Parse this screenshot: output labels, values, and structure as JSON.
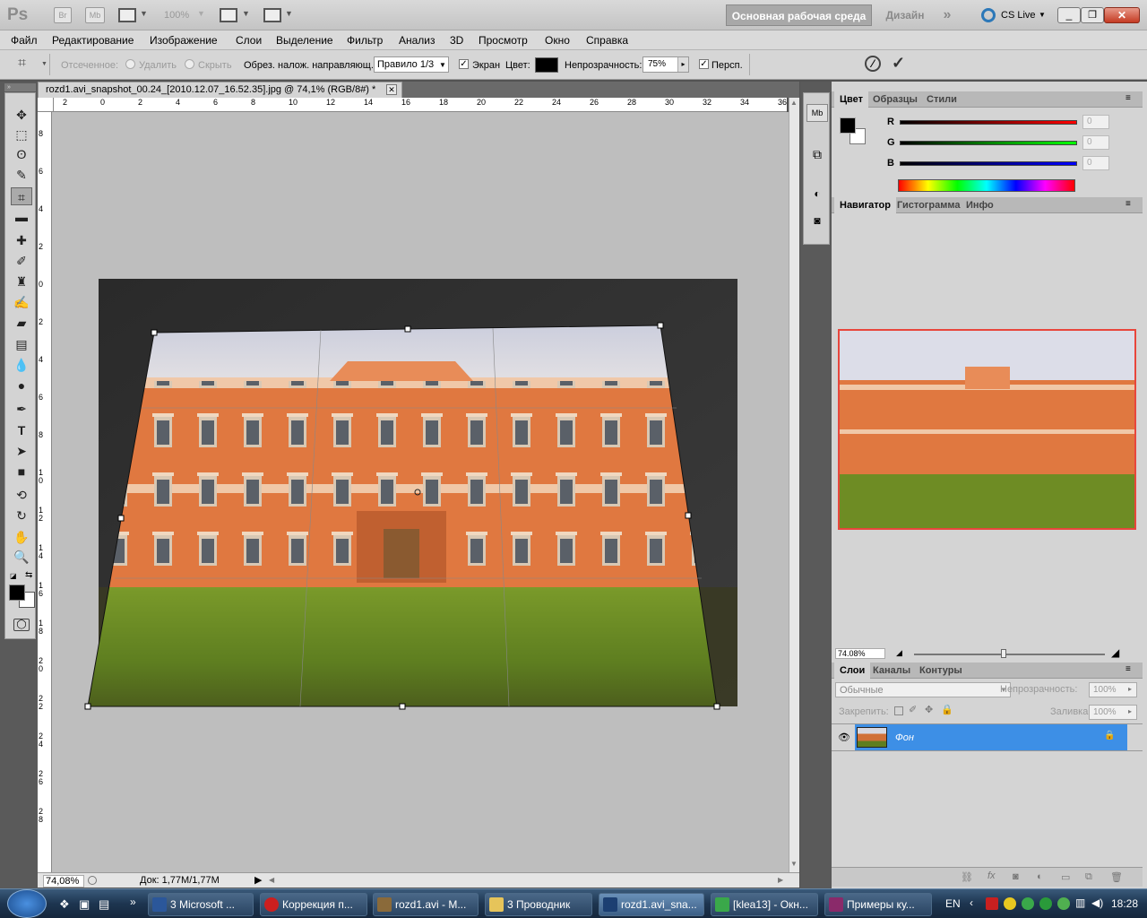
{
  "app": {
    "logo": "Ps",
    "bridge": "Br",
    "minibridge": "Mb",
    "zoom_dropdown": "100%",
    "workspace_active": "Основная рабочая среда",
    "workspace_design": "Дизайн",
    "workspace_more": "»",
    "cs_live": "CS Live"
  },
  "menu": [
    "Файл",
    "Редактирование",
    "Изображение",
    "Слои",
    "Выделение",
    "Фильтр",
    "Анализ",
    "3D",
    "Просмотр",
    "Окно",
    "Справка"
  ],
  "options": {
    "cropped_label": "Отсеченное:",
    "delete_label": "Удалить",
    "hide_label": "Скрыть",
    "overlay_label": "Обрез. налож. направляющ.:",
    "overlay_value": "Правило 1/3",
    "screen_label": "Экран",
    "color_label": "Цвет:",
    "opacity_label": "Непрозрачность:",
    "opacity_value": "75%",
    "perspective_label": "Персп.",
    "screen_checked": true,
    "perspective_checked": true,
    "shield_color": "#000000"
  },
  "document": {
    "tab_title": "rozd1.avi_snapshot_00.24_[2010.12.07_16.52.35].jpg @ 74,1% (RGB/8#) *",
    "ruler_top": [
      "2",
      "0",
      "2",
      "4",
      "6",
      "8",
      "10",
      "12",
      "14",
      "16",
      "18",
      "20",
      "22",
      "24",
      "26",
      "28",
      "30",
      "32",
      "34",
      "36"
    ],
    "ruler_left": [
      "8",
      "6",
      "4",
      "2",
      "0",
      "2",
      "4",
      "6",
      "8",
      "1 0",
      "1 2",
      "1 4",
      "1 6",
      "1 8",
      "2 0",
      "2 2",
      "2 4",
      "2 6",
      "2 8"
    ]
  },
  "status": {
    "zoom": "74,08%",
    "doc_size": "Док: 1,77M/1,77M"
  },
  "color_panel": {
    "tabs": [
      "Цвет",
      "Образцы",
      "Стили"
    ],
    "r_label": "R",
    "g_label": "G",
    "b_label": "B",
    "r_value": "0",
    "g_value": "0",
    "b_value": "0",
    "fg_color": "#000000",
    "bg_color": "#ffffff"
  },
  "navigator_panel": {
    "tabs": [
      "Навигатор",
      "Гистограмма",
      "Инфо"
    ],
    "zoom": "74.08%",
    "view_box_color": "#e8463c"
  },
  "layers_panel": {
    "tabs": [
      "Слои",
      "Каналы",
      "Контуры"
    ],
    "blend_mode": "Обычные",
    "opacity_label": "Непрозрачность:",
    "opacity_value": "100%",
    "lock_label": "Закрепить:",
    "fill_label": "Заливка:",
    "fill_value": "100%",
    "layer_name": "Фон"
  },
  "taskbar": {
    "items": [
      {
        "label": "3 Microsoft ...",
        "color": "#2b579a"
      },
      {
        "label": "Коррекция п...",
        "color": "#cc1f1f"
      },
      {
        "label": "rozd1.avi - M...",
        "color": "#8a6a3a"
      },
      {
        "label": "3 Проводник",
        "color": "#e6c45a"
      },
      {
        "label": "rozd1.avi_sna...",
        "color": "#1c3f72"
      },
      {
        "label": "[klea13] - Окн...",
        "color": "#3aa84a"
      },
      {
        "label": "Примеры ку...",
        "color": "#8a2a6a"
      }
    ],
    "lang": "EN",
    "time": "18:28"
  }
}
